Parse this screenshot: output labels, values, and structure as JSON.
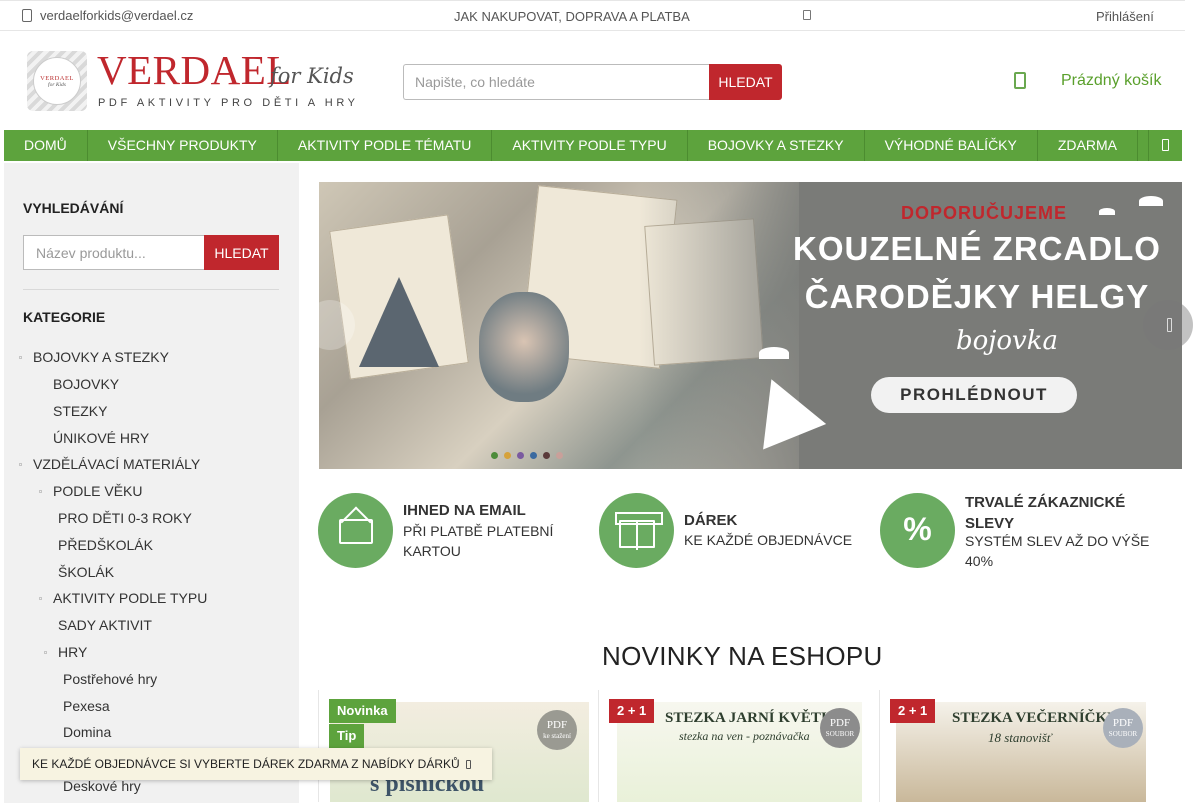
{
  "topbar": {
    "email": "verdaelforkids@verdael.cz",
    "shop_info": "JAK NAKUPOVAT, DOPRAVA A PLATBA",
    "login": "Přihlášení"
  },
  "header": {
    "logo": {
      "name": "VERDAEL",
      "suffix": "for Kids",
      "tagline": "PDF AKTIVITY PRO DĚTI A HRY",
      "badge_text": "VERDAEL",
      "badge_sub": "for Kids"
    },
    "search": {
      "placeholder": "Napište, co hledáte",
      "button": "HLEDAT"
    },
    "cart": {
      "label": "Prázdný košík",
      "icon": "cart-icon"
    }
  },
  "nav": {
    "items": [
      "DOMŮ",
      "VŠECHNY PRODUKTY",
      "AKTIVITY PODLE TÉMATU",
      "AKTIVITY PODLE TYPU",
      "BOJOVKY A STEZKY",
      "VÝHODNÉ BALÍČKY",
      "ZDARMA"
    ]
  },
  "sidebar": {
    "search_heading": "VYHLEDÁVÁNÍ",
    "search_placeholder": "Název produktu...",
    "search_button": "HLEDAT",
    "categories_heading": "KATEGORIE",
    "categories": [
      "BOJOVKY A STEZKY",
      "BOJOVKY",
      "STEZKY",
      "ÚNIKOVÉ HRY",
      "VZDĚLÁVACÍ MATERIÁLY",
      "PODLE VĚKU",
      "PRO DĚTI 0-3 ROKY",
      "PŘEDŠKOLÁK",
      "ŠKOLÁK",
      "AKTIVITY PODLE TYPU",
      "SADY AKTIVIT",
      "HRY",
      "Postřehové hry",
      "Pexesa",
      "Domina",
      "Deskové hry"
    ]
  },
  "slider": {
    "kicker": "DOPORUČUJEME",
    "title_line1": "KOUZELNÉ ZRCADLO",
    "title_line2": "ČARODĚJKY HELGY",
    "subtitle": "bojovka",
    "cta": "PROHLÉDNOUT",
    "colors": {
      "kicker": "#c0272d",
      "background": "#7a7b78"
    }
  },
  "benefits": [
    {
      "title": "IHNED NA EMAIL",
      "text": "PŘI PLATBĚ PLATEBNÍ KARTOU",
      "icon": "envelope-icon"
    },
    {
      "title": "DÁREK",
      "text": "KE KAŽDÉ OBJEDNÁVCE",
      "icon": "gift-icon"
    },
    {
      "title": "TRVALÉ ZÁKAZNICKÉ SLEVY",
      "text": "SYSTÉM SLEV AŽ DO VÝŠE 40%",
      "icon": "percent-icon",
      "icon_text": "%"
    }
  ],
  "news": {
    "heading": "NOVINKY NA ESHOPU",
    "products": [
      {
        "flags": [
          "Novinka",
          "Tip"
        ],
        "title": "Čeština ...ou s písničkou",
        "title_visible": "ou\ns písničkou",
        "pdf_label": "PDF",
        "pdf_sub": "ke stažení"
      },
      {
        "flags": [
          "2 + 1"
        ],
        "title": "STEZKA JARNÍ KVĚTINY",
        "subtitle": "stezka na ven - poznávačka",
        "pdf_label": "PDF",
        "pdf_sub": "SOUBOR"
      },
      {
        "flags": [
          "2 + 1"
        ],
        "title": "STEZKA VEČERNÍČKY",
        "subtitle": "18 stanovišť",
        "pdf_label": "PDF",
        "pdf_sub": "SOUBOR"
      }
    ]
  },
  "notice": {
    "text": "KE KAŽDÉ OBJEDNÁVCE SI VYBERTE DÁREK ZDARMA Z NABÍDKY DÁRKŮ"
  },
  "colors": {
    "brand_red": "#c0272d",
    "nav_green": "#5da33d",
    "accent_green": "#6aab61"
  }
}
